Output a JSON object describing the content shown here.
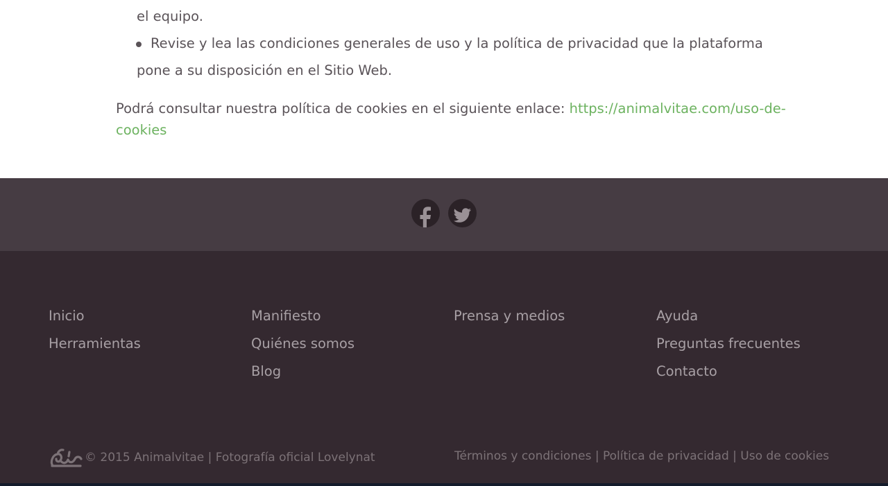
{
  "content": {
    "line1": "el equipo.",
    "bullet_line1": "Revise y lea las condiciones generales de uso y la política de privacidad que la plataforma",
    "bullet_line2": "pone a su disposición en el Sitio Web.",
    "cookies_text": " Podrá consultar nuestra política de cookies en el siguiente enlace: ",
    "cookies_link_part1": "https://animalvitae.com/uso-de-",
    "cookies_link_part2": "cookies"
  },
  "social": [
    {
      "name": "facebook-icon",
      "glyph": "f"
    },
    {
      "name": "twitter-icon",
      "glyph": "twitter"
    }
  ],
  "footer": {
    "col1": [
      "Inicio",
      "Herramientas"
    ],
    "col2": [
      "Manifiesto",
      "Quiénes somos",
      "Blog"
    ],
    "col3": [
      "Prensa y medios"
    ],
    "col4": [
      "Ayuda",
      "Preguntas frecuentes",
      "Contacto"
    ]
  },
  "bottom": {
    "copyright": "© 2015 Animalvitae | Fotografía oficial Lovelynat",
    "terms": "Términos y condiciones",
    "sep1": " | ",
    "privacy": "Política de privacidad",
    "sep2": " | ",
    "cookies": "Uso de cookies"
  },
  "colors": {
    "link": "#6cb25f",
    "social_band": "#463c43",
    "footer_bg": "#342930",
    "footer_text": "#a8a0a5"
  }
}
